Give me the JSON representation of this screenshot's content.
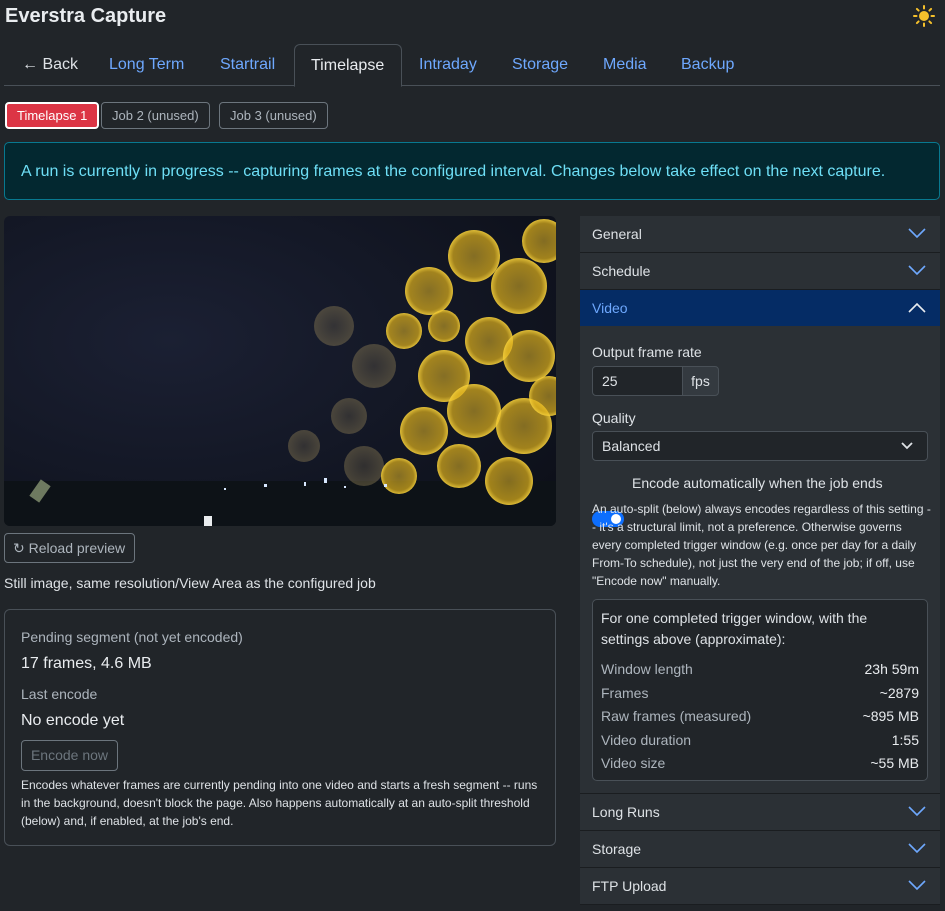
{
  "app": {
    "title": "Everstra Capture"
  },
  "nav": {
    "back": "← Back",
    "tabs": [
      "Long Term",
      "Startrail",
      "Timelapse",
      "Intraday",
      "Storage",
      "Media",
      "Backup"
    ],
    "active": "Timelapse"
  },
  "jobs": [
    "Timelapse 1",
    "Job 2 (unused)",
    "Job 3 (unused)"
  ],
  "alert": "A run is currently in progress -- capturing frames at the configured interval. Changes below take effect on the next capture.",
  "preview": {
    "reload": "Reload preview",
    "caption": "Still image, same resolution/View Area as the configured job"
  },
  "segment": {
    "pending_label": "Pending segment (not yet encoded)",
    "pending_value": "17 frames, 4.6 MB",
    "last_label": "Last encode",
    "last_value": "No encode yet",
    "encode_button": "Encode now",
    "note": "Encodes whatever frames are currently pending into one video and starts a fresh segment -- runs in the background, doesn't block the page. Also happens automatically at an auto-split threshold (below) and, if enabled, at the job's end."
  },
  "sections": {
    "general": "General",
    "schedule": "Schedule",
    "video": "Video",
    "long_runs": "Long Runs",
    "storage": "Storage",
    "ftp": "FTP Upload"
  },
  "video": {
    "fps_label": "Output frame rate",
    "fps_value": "25",
    "fps_unit": "fps",
    "quality_label": "Quality",
    "quality_value": "Balanced",
    "auto_encode_label": "Encode automatically when the job ends",
    "auto_encode_on": true,
    "auto_encode_help": "An auto-split (below) always encodes regardless of this setting -- it's a structural limit, not a preference. Otherwise governs every completed trigger window (e.g. once per day for a daily From-To schedule), not just the very end of the job; if off, use \"Encode now\" manually.",
    "estimate": {
      "intro": "For one completed trigger window, with the settings above (approximate):",
      "rows": [
        {
          "k": "Window length",
          "v": "23h 59m"
        },
        {
          "k": "Frames",
          "v": "~2879"
        },
        {
          "k": "Raw frames (measured)",
          "v": "~895 MB"
        },
        {
          "k": "Video duration",
          "v": "1:55"
        },
        {
          "k": "Video size",
          "v": "~55 MB"
        }
      ]
    }
  },
  "colors": {
    "accent": "#6ea8fe",
    "danger": "#dc3545",
    "info": "#6edff6",
    "switch": "#0d6efd"
  }
}
